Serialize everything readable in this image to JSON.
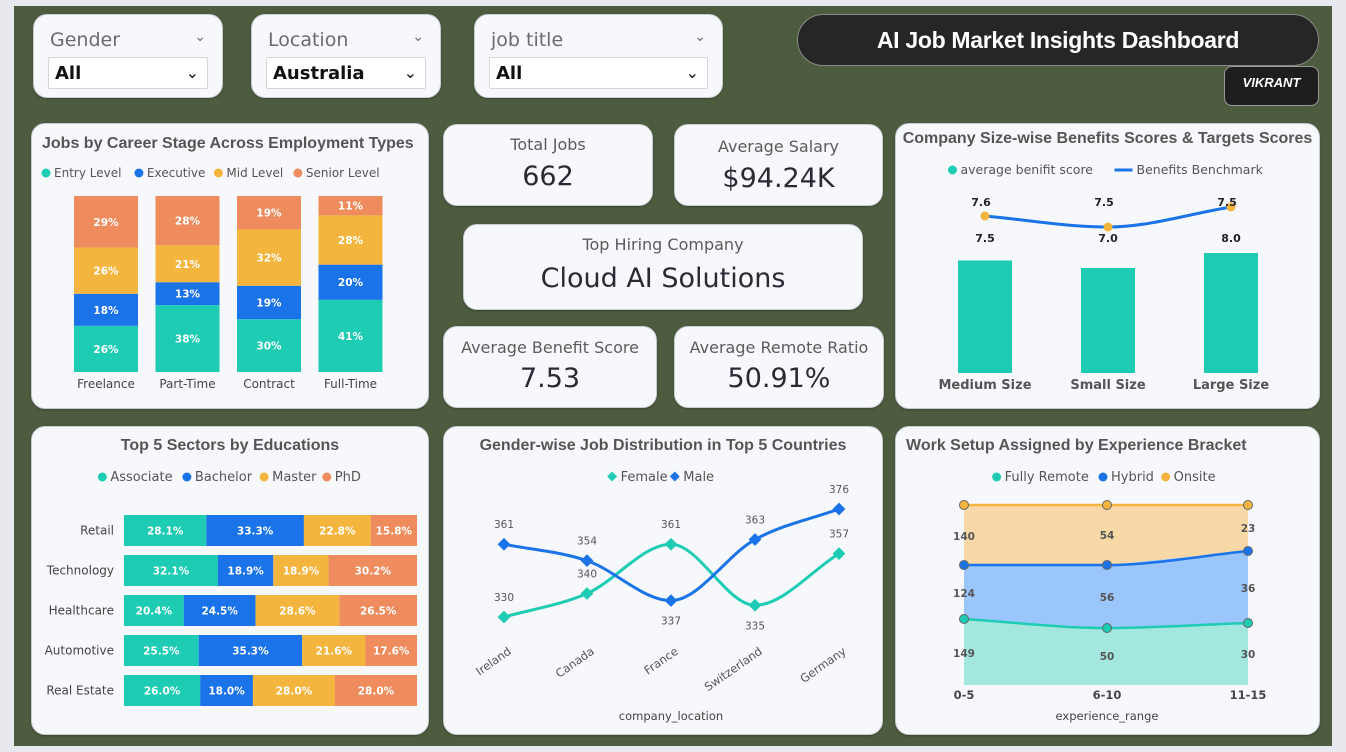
{
  "slicers": [
    {
      "label": "Gender",
      "value": "All"
    },
    {
      "label": "Location",
      "value": "Australia"
    },
    {
      "label": "job title",
      "value": "All"
    }
  ],
  "header": {
    "title": "AI Job Market Insights Dashboard",
    "author": "VIKRANT"
  },
  "kpis": {
    "total_jobs_label": "Total Jobs",
    "total_jobs": "662",
    "avg_salary_label": "Average Salary",
    "avg_salary": "$94.24K",
    "top_company_label": "Top Hiring Company",
    "top_company": "Cloud AI Solutions",
    "avg_benefit_label": "Average Benefit Score",
    "avg_benefit": "7.53",
    "avg_remote_label": "Average Remote Ratio",
    "avg_remote": "50.91%"
  },
  "colors": {
    "teal": "#1ecbb3",
    "blue": "#1a73e8",
    "yellow": "#f4b53f",
    "orange": "#ef8c5d"
  },
  "chart_data": [
    {
      "id": "career",
      "type": "bar",
      "stacked": "percent",
      "title": "Jobs by Career Stage Across Employment Types",
      "categories": [
        "Freelance",
        "Part-Time",
        "Contract",
        "Full-Time"
      ],
      "series": [
        {
          "name": "Entry Level",
          "values": [
            26,
            38,
            30,
            41
          ],
          "color": "#1ecbb3"
        },
        {
          "name": "Executive",
          "values": [
            18,
            13,
            19,
            20
          ],
          "color": "#1a73e8"
        },
        {
          "name": "Mid Level",
          "values": [
            26,
            21,
            32,
            28
          ],
          "color": "#f4b53f"
        },
        {
          "name": "Senior Level",
          "values": [
            29,
            28,
            19,
            11
          ],
          "color": "#ef8c5d"
        }
      ]
    },
    {
      "id": "benefits",
      "type": "bar",
      "title": "Company Size-wise Benefits Scores & Targets Scores",
      "categories": [
        "Medium Size",
        "Small Size",
        "Large Size"
      ],
      "series": [
        {
          "name": "average benifit score",
          "values": [
            7.5,
            7.0,
            8.0
          ],
          "color": "#1ecbb3"
        },
        {
          "name": "Benefits Benchmark",
          "values": [
            7.6,
            7.5,
            7.5
          ],
          "color": "#1a73e8",
          "kind": "line"
        }
      ],
      "bar_labels": [
        "7.5",
        "7.0",
        "8.0"
      ],
      "line_labels": [
        "7.6",
        "7.5",
        "7.5"
      ]
    },
    {
      "id": "sectors",
      "type": "bar",
      "orientation": "horizontal",
      "stacked": "percent",
      "title": "Top 5 Sectors by Educations",
      "categories": [
        "Retail",
        "Technology",
        "Healthcare",
        "Automotive",
        "Real Estate"
      ],
      "series": [
        {
          "name": "Associate",
          "values": [
            28.1,
            32.1,
            20.4,
            25.5,
            26.0
          ],
          "color": "#1ecbb3"
        },
        {
          "name": "Bachelor",
          "values": [
            33.3,
            18.9,
            24.5,
            35.3,
            18.0
          ],
          "color": "#1a73e8"
        },
        {
          "name": "Master",
          "values": [
            22.8,
            18.9,
            28.6,
            21.6,
            28.0
          ],
          "color": "#f4b53f"
        },
        {
          "name": "PhD",
          "values": [
            15.8,
            30.2,
            26.5,
            17.6,
            28.0
          ],
          "color": "#ef8c5d"
        }
      ]
    },
    {
      "id": "gender",
      "type": "line",
      "title": "Gender-wise Job Distribution in Top 5 Countries",
      "xlabel": "company_location",
      "categories": [
        "Ireland",
        "Canada",
        "France",
        "Switzerland",
        "Germany"
      ],
      "series": [
        {
          "name": "Female",
          "values": [
            330,
            340,
            361,
            335,
            357
          ],
          "color": "#1ecbb3"
        },
        {
          "name": "Male",
          "values": [
            361,
            354,
            337,
            363,
            376
          ],
          "color": "#1a73e8"
        }
      ]
    },
    {
      "id": "worksetup",
      "type": "area",
      "stacked": true,
      "title": "Work Setup Assigned by Experience Bracket",
      "xlabel": "experience_range",
      "categories": [
        "0-5",
        "6-10",
        "11-15"
      ],
      "series": [
        {
          "name": "Fully Remote",
          "values": [
            149,
            50,
            30
          ],
          "color": "#1ecbb3"
        },
        {
          "name": "Hybrid",
          "values": [
            124,
            56,
            36
          ],
          "color": "#1a73e8"
        },
        {
          "name": "Onsite",
          "values": [
            140,
            54,
            23
          ],
          "color": "#f4b53f"
        }
      ]
    }
  ]
}
